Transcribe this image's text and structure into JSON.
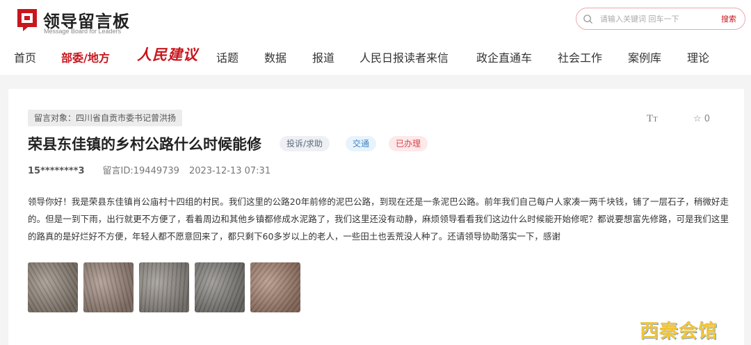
{
  "header": {
    "logo_title": "领导留言板",
    "logo_subtitle": "Message Board for Leaders",
    "search": {
      "placeholder": "请输入关键词 回车一下",
      "button_label": "搜索"
    }
  },
  "nav": {
    "items": [
      "首页",
      "部委/地方",
      "人民建议",
      "话题",
      "数据",
      "报道",
      "人民日报读者来信",
      "政企直通车",
      "社会工作",
      "案例库",
      "理论"
    ],
    "active_index": 1
  },
  "message": {
    "target_label": "留言对象：四川省自贡市委书记曾洪扬",
    "title": "荣县东佳镇的乡村公路什么时候能修",
    "badges": {
      "type": "投诉/求助",
      "field": "交通",
      "status": "已办理"
    },
    "user": "15********3",
    "message_id": "留言ID:19449739",
    "datetime": "2023-12-13 07:31",
    "font_size_icon": "TT",
    "favorite": {
      "icon": "star-outline-icon",
      "count": "0"
    },
    "body": "领导你好！我是荣县东佳镇肖公庙村十四组的村民。我们这里的公路20年前修的泥巴公路，到现在还是一条泥巴公路。前年我们自己每户人家凑一两千块钱，铺了一层石子，稍微好走的。但是一到下雨，出行就更不方便了，看着周边和其他乡镇都修成水泥路了，我们这里还没有动静，麻烦领导看看我们这边什么时候能开始修呢？都说要想富先修路，可是我们这里的路真的是好烂好不方便，年轻人都不愿意回来了，都只剩下60多岁以上的老人，一些田土也丢荒没人种了。还请领导协助落实一下，感谢",
    "photos": [
      {
        "label": "muddy-road-photo-1",
        "color": "#8e8275"
      },
      {
        "label": "muddy-road-photo-2",
        "color": "#9a8478"
      },
      {
        "label": "muddy-road-photo-3",
        "color": "#8d8780"
      },
      {
        "label": "muddy-road-photo-4",
        "color": "#7f7c77"
      },
      {
        "label": "muddy-road-photo-5",
        "color": "#a47f6c"
      }
    ]
  },
  "watermark": "西秦会馆",
  "colors": {
    "brand_red": "#c8161d",
    "badge_blue": "#3d86c6",
    "badge_status_red": "#d9464d",
    "watermark_yellow": "#f2c335"
  }
}
